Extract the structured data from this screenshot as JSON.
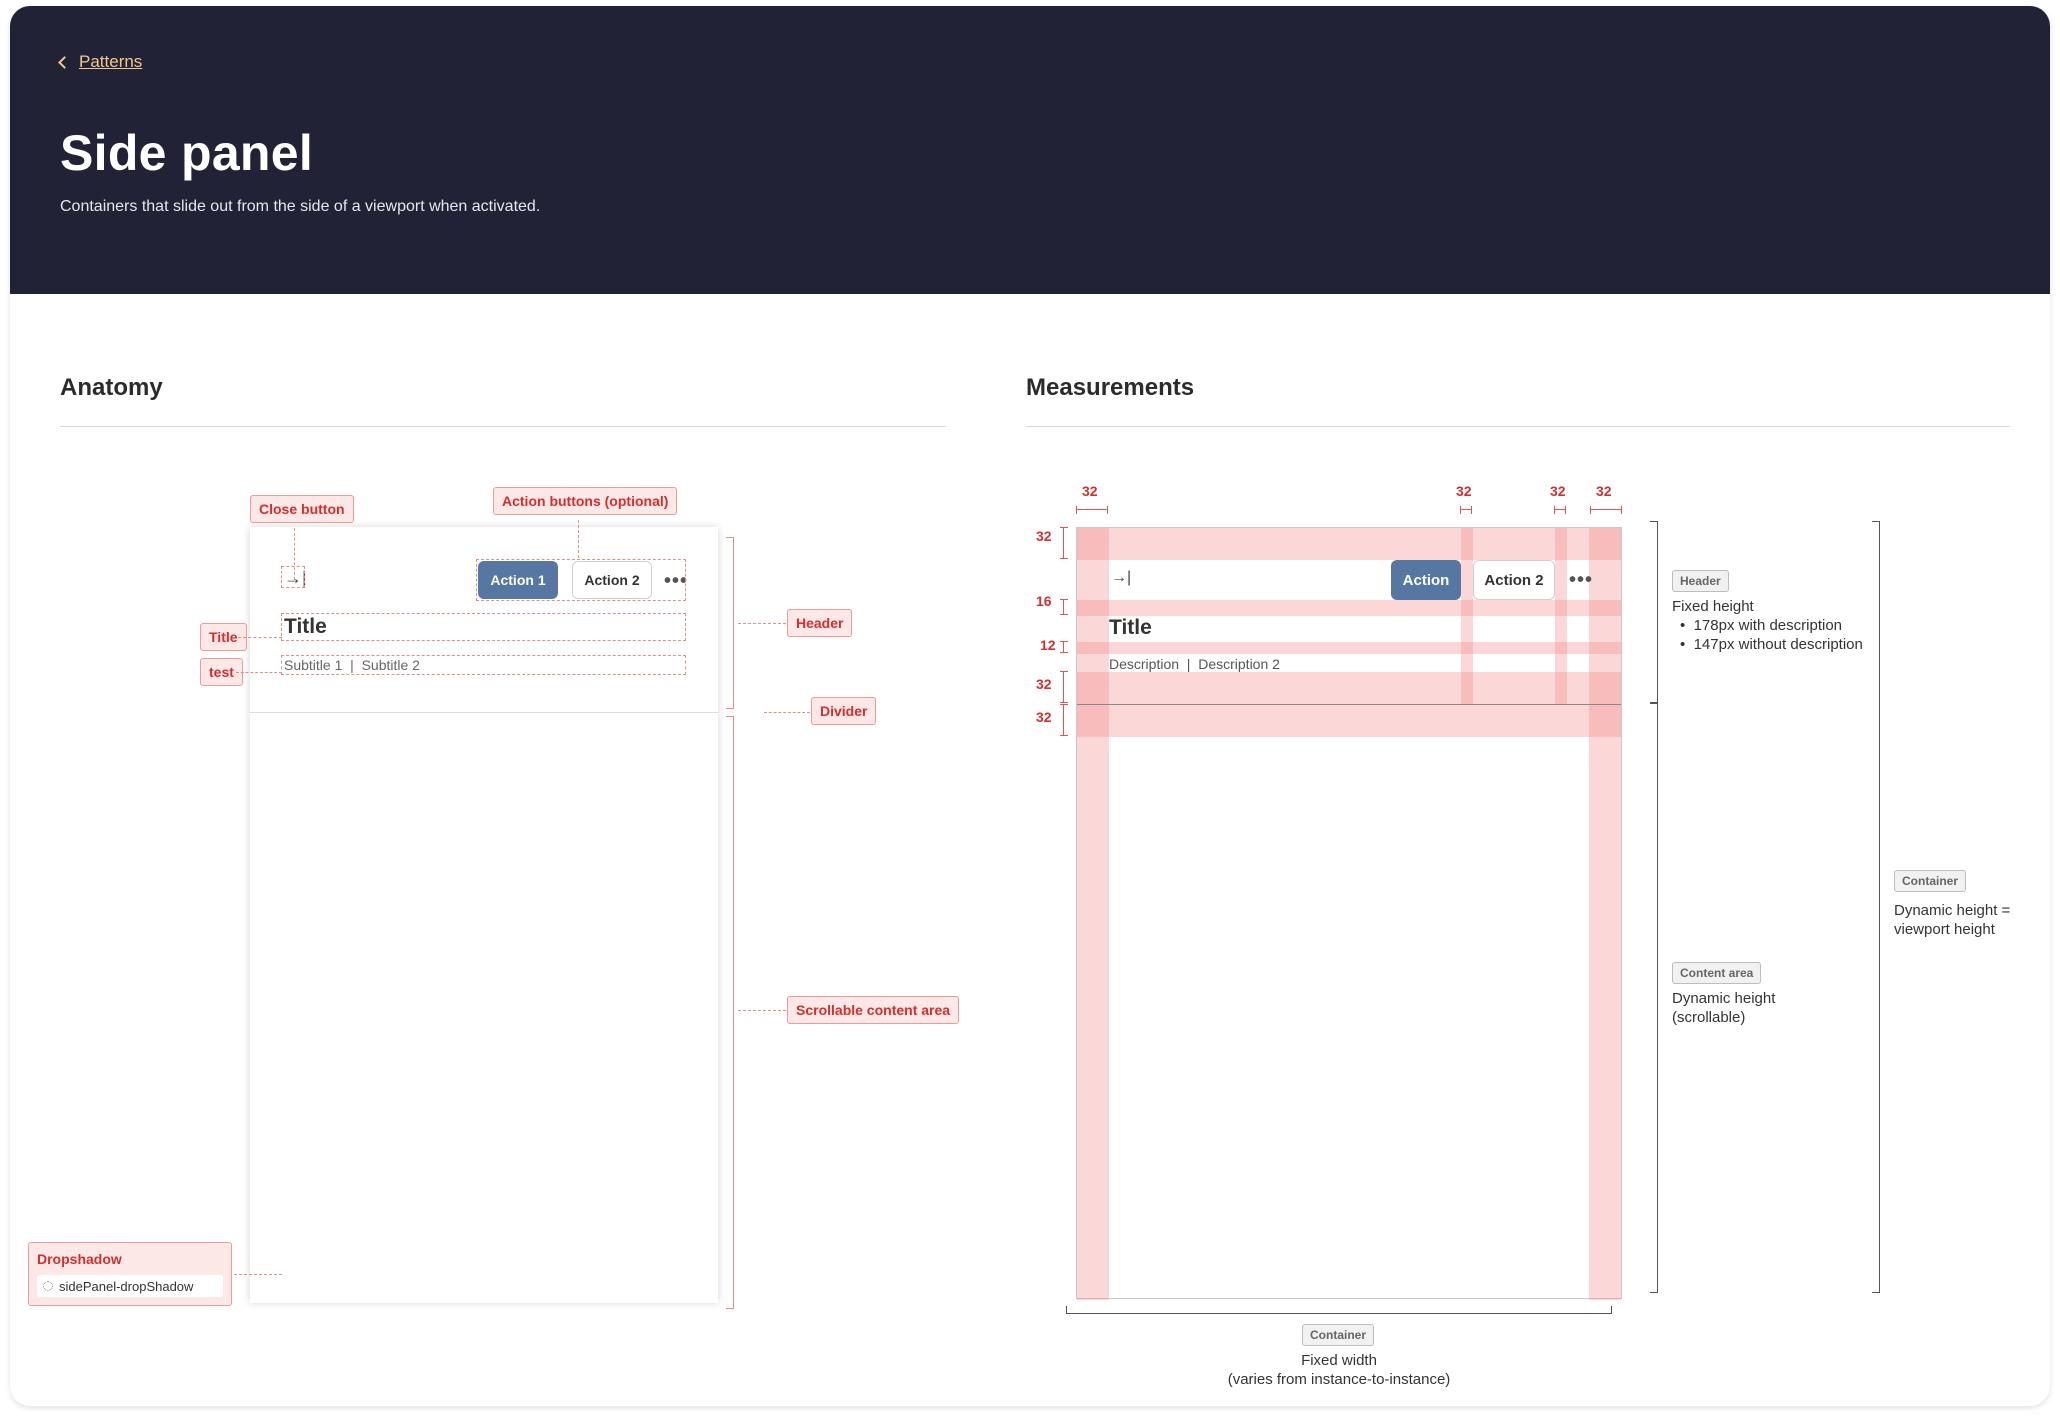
{
  "breadcrumb": {
    "label": "Patterns"
  },
  "hero": {
    "title": "Side panel",
    "description": "Containers that slide out from the side of a viewport when activated."
  },
  "anatomy": {
    "heading": "Anatomy",
    "tags": {
      "close": "Close button",
      "actions": "Action buttons (optional)",
      "title": "Title",
      "test": "test",
      "header": "Header",
      "divider": "Divider",
      "scroll": "Scrollable content area",
      "dropshadow": "Dropshadow",
      "shadow_token": "sidePanel-dropShadow"
    },
    "panel": {
      "action1": "Action 1",
      "action2": "Action 2",
      "more": "•••",
      "close_glyph": "→|",
      "title": "Title",
      "subtitle": "Subtitle 1  |  Subtitle 2"
    }
  },
  "measurements": {
    "heading": "Measurements",
    "top_dims": [
      "32",
      "32",
      "32",
      "32"
    ],
    "left_dims": [
      "32",
      "16",
      "12",
      "32",
      "32"
    ],
    "panel": {
      "action": "Action",
      "action2": "Action 2",
      "more": "•••",
      "close_glyph": "→|",
      "title": "Title",
      "description": "Description  |  Description 2"
    },
    "header_note": {
      "tag": "Header",
      "line1": "Fixed height",
      "line2": "•  178px with description",
      "line3": "•  147px without description"
    },
    "content_note": {
      "tag": "Content area",
      "line1": "Dynamic height",
      "line2": "(scrollable)"
    },
    "container_note": {
      "tag": "Container",
      "line1": "Dynamic height =",
      "line2": "viewport height"
    },
    "width_note": {
      "tag": "Container",
      "line1": "Fixed width",
      "line2": "(varies from instance-to-instance)"
    }
  },
  "colors": {
    "hero_bg": "#212235",
    "accent_link": "#f2c98a",
    "primary_button": "#5577a2",
    "annotation_red": "#d32f2f",
    "spacing_band": "#f6c2c2"
  }
}
